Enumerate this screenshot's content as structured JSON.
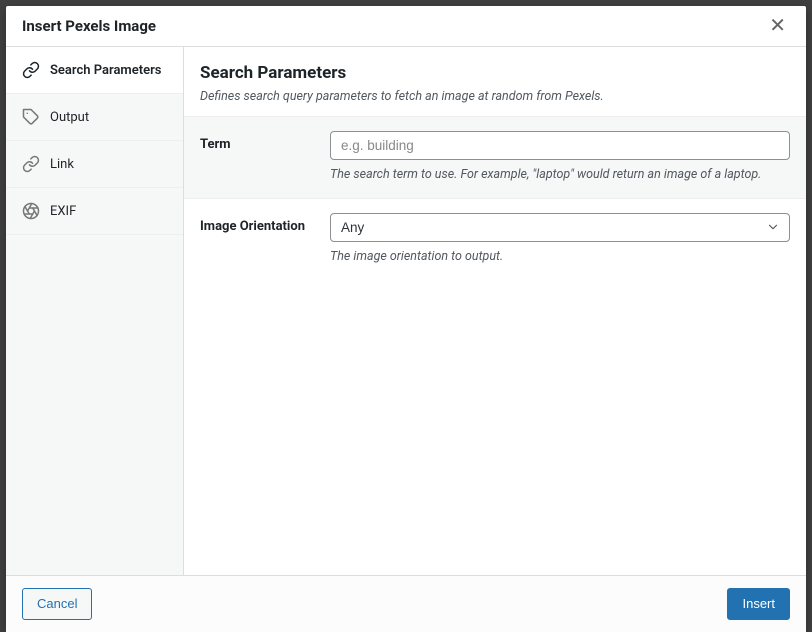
{
  "modal": {
    "title": "Insert Pexels Image"
  },
  "sidebar": {
    "items": [
      {
        "label": "Search Parameters"
      },
      {
        "label": "Output"
      },
      {
        "label": "Link"
      },
      {
        "label": "EXIF"
      }
    ]
  },
  "panel": {
    "title": "Search Parameters",
    "description": "Defines search query parameters to fetch an image at random from Pexels."
  },
  "fields": {
    "term": {
      "label": "Term",
      "placeholder": "e.g. building",
      "value": "",
      "help": "The search term to use. For example, \"laptop\" would return an image of a laptop."
    },
    "orientation": {
      "label": "Image Orientation",
      "value": "Any",
      "help": "The image orientation to output."
    }
  },
  "footer": {
    "cancel": "Cancel",
    "insert": "Insert"
  }
}
